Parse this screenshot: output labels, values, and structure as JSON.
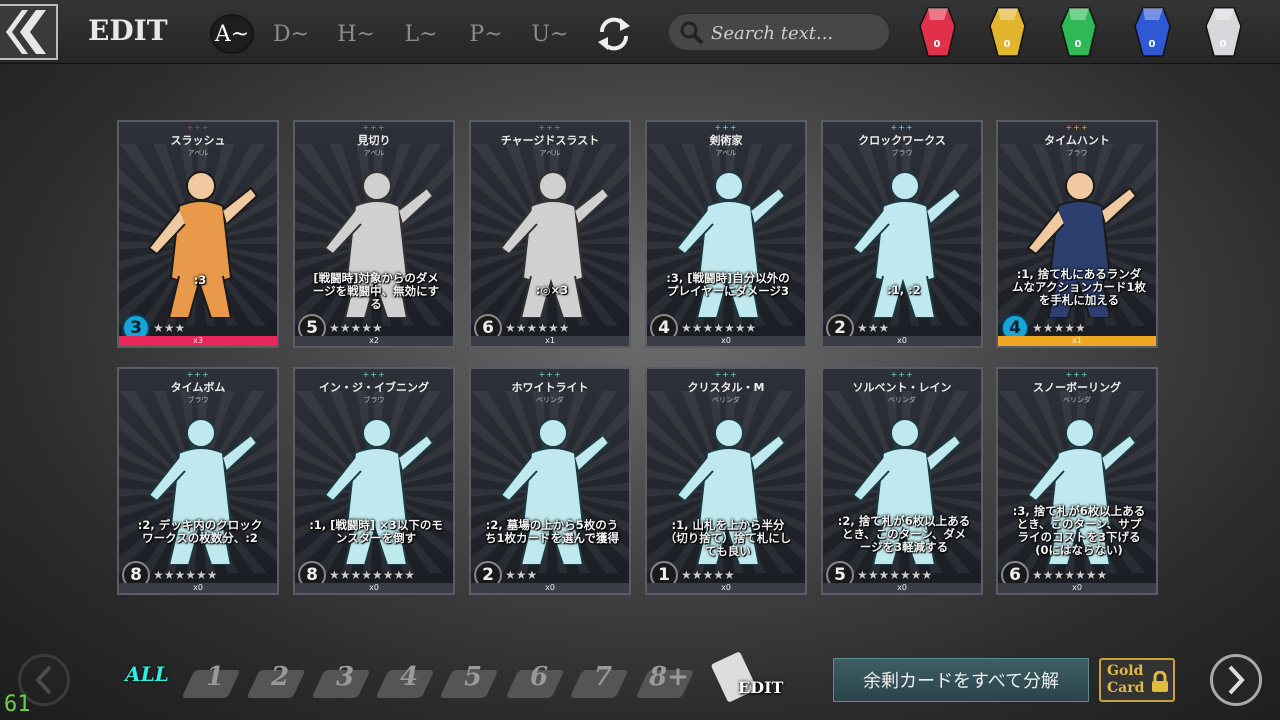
{
  "header": {
    "title": "EDIT",
    "filters": [
      "A~",
      "D~",
      "H~",
      "L~",
      "P~",
      "U~"
    ],
    "active_filter": 0,
    "search_placeholder": "Search text..."
  },
  "gems": [
    {
      "name": "red-gem-icon",
      "color": "#e0304a",
      "count": "0"
    },
    {
      "name": "yellow-gem-icon",
      "color": "#e2b52c",
      "count": "0"
    },
    {
      "name": "green-gem-icon",
      "color": "#2fb856",
      "count": "0"
    },
    {
      "name": "blue-gem-icon",
      "color": "#2f58d4",
      "count": "0"
    },
    {
      "name": "white-gem-icon",
      "color": "#d8d8dc",
      "count": "0"
    }
  ],
  "cards": [
    {
      "name": "スラッシュ",
      "owner": "アベル",
      "effect": ":3",
      "cost": "3",
      "stars": "★★★",
      "count": "x3",
      "plus_color": "#e8265a",
      "cost_style": "blue",
      "bar": "red",
      "tone": "color"
    },
    {
      "name": "見切り",
      "owner": "アベル",
      "effect": "[戦闘時]対象からのダメージを戦闘中、無効にする",
      "cost": "5",
      "stars": "★★★★★",
      "count": "x2",
      "plus_color": "#888",
      "cost_style": "grey",
      "bar": "grey",
      "tone": "grey"
    },
    {
      "name": "チャージドスラスト",
      "owner": "アベル",
      "effect": ":◎×3",
      "cost": "6",
      "stars": "★★★★★★",
      "count": "x1",
      "plus_color": "#888",
      "cost_style": "grey",
      "bar": "grey",
      "tone": "grey"
    },
    {
      "name": "剣術家",
      "owner": "アベル",
      "effect": ":3, [戦闘時]自分以外のプレイヤーにダメージ3",
      "cost": "4",
      "stars": "★★★★★★★",
      "count": "x0",
      "plus_color": "#6fd6e0",
      "cost_style": "grey",
      "bar": "grey",
      "tone": "cyan"
    },
    {
      "name": "クロックワークス",
      "owner": "ブラウ",
      "effect": ":1, :2",
      "cost": "2",
      "stars": "★★★",
      "count": "x0",
      "plus_color": "#6fd6e0",
      "cost_style": "grey",
      "bar": "grey",
      "tone": "cyan"
    },
    {
      "name": "タイムハント",
      "owner": "ブラウ",
      "effect": ":1, 捨て札にあるランダムなアクションカード1枚を手札に加える",
      "cost": "4",
      "stars": "★★★★★",
      "count": "x1",
      "plus_color": "#f0a824",
      "cost_style": "blue",
      "bar": "orange",
      "tone": "color"
    },
    {
      "name": "タイムボム",
      "owner": "ブラウ",
      "effect": ":2, デッキ内のクロックワークスの枚数分、:2",
      "cost": "8",
      "stars": "★★★★★★",
      "count": "x0",
      "plus_color": "#6fd6e0",
      "cost_style": "grey",
      "bar": "grey",
      "tone": "cyan"
    },
    {
      "name": "イン・ジ・イブニング",
      "owner": "ブラウ",
      "effect": ":1, [戦闘時] ×3以下のモンスターを倒す",
      "cost": "8",
      "stars": "★★★★★★★★",
      "count": "x0",
      "plus_color": "#6fd6e0",
      "cost_style": "grey",
      "bar": "grey",
      "tone": "cyan"
    },
    {
      "name": "ホワイトライト",
      "owner": "ベリンダ",
      "effect": ":2, 墓場の上から5枚のうち1枚カードを選んで獲得",
      "cost": "2",
      "stars": "★★★",
      "count": "x0",
      "plus_color": "#6fd6e0",
      "cost_style": "grey",
      "bar": "grey",
      "tone": "cyan"
    },
    {
      "name": "クリスタル・M",
      "owner": "ベリンダ",
      "effect": ":1, 山札を上から半分（切り捨て）捨て札にしても良い",
      "cost": "1",
      "stars": "★★★★★",
      "count": "x0",
      "plus_color": "#6fd6e0",
      "cost_style": "grey",
      "bar": "grey",
      "tone": "cyan"
    },
    {
      "name": "ソルベント・レイン",
      "owner": "ベリンダ",
      "effect": ":2, 捨て札が6枚以上あるとき、このターン、ダメージを3軽減する",
      "cost": "5",
      "stars": "★★★★★★★",
      "count": "x0",
      "plus_color": "#6fd6e0",
      "cost_style": "grey",
      "bar": "grey",
      "tone": "cyan"
    },
    {
      "name": "スノーボーリング",
      "owner": "ベリンダ",
      "effect": ":3, 捨て札が6枚以上あるとき、このターン、サプライのコストを3下げる(0にはならない)",
      "cost": "6",
      "stars": "★★★★★★★",
      "count": "x0",
      "plus_color": "#6fd6e0",
      "cost_style": "grey",
      "bar": "grey",
      "tone": "cyan"
    }
  ],
  "footer": {
    "cost_filters": [
      "ALL",
      "1",
      "2",
      "3",
      "4",
      "5",
      "6",
      "7",
      "8+"
    ],
    "edit_label": "EDIT",
    "dismantle_label": "余剰カードをすべて分解",
    "gold_card_label_1": "Gold",
    "gold_card_label_2": "Card",
    "fps": "61"
  }
}
